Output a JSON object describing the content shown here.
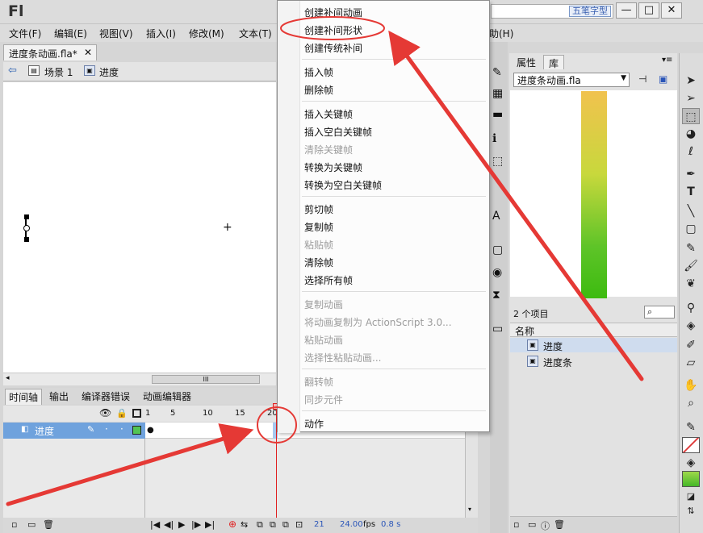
{
  "app": {
    "logo": "Fl",
    "search_tag": "五笔字型"
  },
  "window_buttons": [
    "—",
    "□",
    "✕"
  ],
  "menubar": [
    "文件(F)",
    "编辑(E)",
    "视图(V)",
    "插入(I)",
    "修改(M)",
    "文本(T)",
    "助(H)"
  ],
  "document_tab": {
    "label": "进度条动画.fla*",
    "close": "✕"
  },
  "scenebar": {
    "scene": "场景 1",
    "symbol": "进度"
  },
  "stage": {
    "crosshair": "+",
    "hscroll_grip": "III"
  },
  "timeline": {
    "tabs": [
      "时间轴",
      "输出",
      "编译器错误",
      "动画编辑器"
    ],
    "frame_numbers": [
      "1",
      "5",
      "10",
      "15",
      "20"
    ],
    "layer_name": "进度",
    "status": {
      "frame": "21",
      "fps": "24.00",
      "fps_unit": "fps",
      "time": "0.8 s"
    }
  },
  "context_menu": {
    "groups": [
      [
        {
          "label": "创建补间动画",
          "enabled": true
        },
        {
          "label": "创建补间形状",
          "enabled": true,
          "highlighted": true
        },
        {
          "label": "创建传统补间",
          "enabled": true
        }
      ],
      [
        {
          "label": "插入帧",
          "enabled": true
        },
        {
          "label": "删除帧",
          "enabled": true
        }
      ],
      [
        {
          "label": "插入关键帧",
          "enabled": true
        },
        {
          "label": "插入空白关键帧",
          "enabled": true
        },
        {
          "label": "清除关键帧",
          "enabled": false
        },
        {
          "label": "转换为关键帧",
          "enabled": true
        },
        {
          "label": "转换为空白关键帧",
          "enabled": true
        }
      ],
      [
        {
          "label": "剪切帧",
          "enabled": true
        },
        {
          "label": "复制帧",
          "enabled": true
        },
        {
          "label": "粘贴帧",
          "enabled": false
        },
        {
          "label": "清除帧",
          "enabled": true
        },
        {
          "label": "选择所有帧",
          "enabled": true
        }
      ],
      [
        {
          "label": "复制动画",
          "enabled": false
        },
        {
          "label": "将动画复制为 ActionScript 3.0...",
          "enabled": false
        },
        {
          "label": "粘贴动画",
          "enabled": false
        },
        {
          "label": "选择性粘贴动画...",
          "enabled": false
        }
      ],
      [
        {
          "label": "翻转帧",
          "enabled": false
        },
        {
          "label": "同步元件",
          "enabled": false
        }
      ],
      [
        {
          "label": "动作",
          "enabled": true
        }
      ]
    ]
  },
  "library_panel": {
    "tabs": [
      "属性",
      "库"
    ],
    "document": "进度条动画.fla",
    "item_count": "2 个项目",
    "column_name": "名称",
    "items": [
      "进度",
      "进度条"
    ]
  },
  "colors": {
    "annotation_red": "#e53935",
    "selection_blue": "#6fa2dd",
    "playhead": "#e02020"
  }
}
